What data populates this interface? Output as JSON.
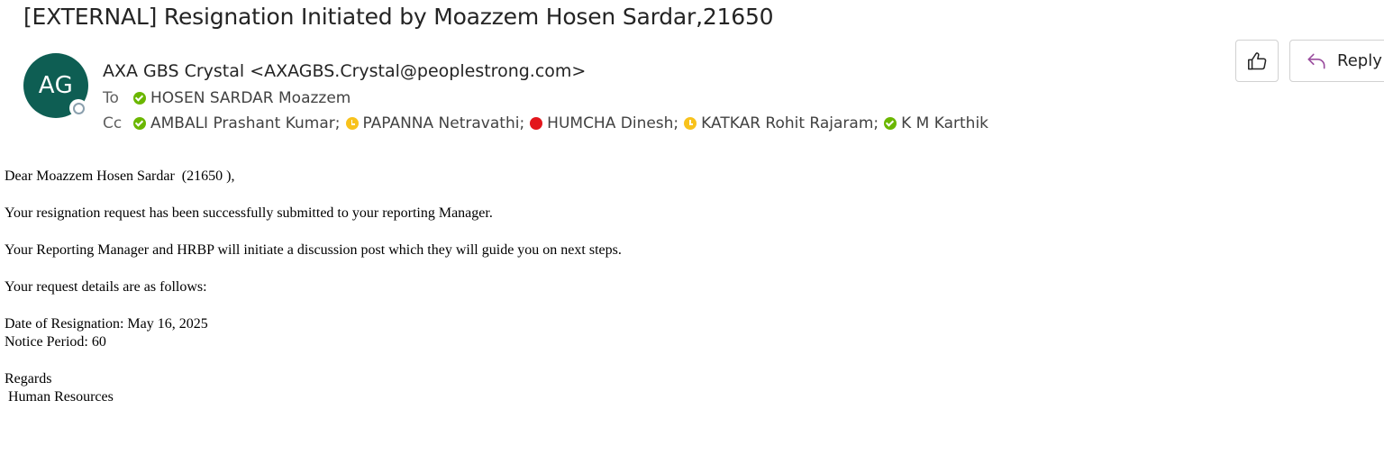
{
  "email": {
    "subject": "[EXTERNAL] Resignation Initiated by Moazzem Hosen Sardar,21650",
    "sender": {
      "initials": "AG",
      "display": "AXA GBS Crystal <AXAGBS.Crystal@peoplestrong.com>",
      "avatar_color": "#0e5e53"
    },
    "to_label": "To",
    "cc_label": "Cc",
    "to": [
      {
        "name": "HOSEN SARDAR Moazzem",
        "status": "available"
      }
    ],
    "cc": [
      {
        "name": "AMBALI Prashant Kumar;",
        "status": "available"
      },
      {
        "name": "PAPANNA Netravathi;",
        "status": "away"
      },
      {
        "name": "HUMCHA Dinesh;",
        "status": "busy"
      },
      {
        "name": "KATKAR Rohit Rajaram;",
        "status": "away"
      },
      {
        "name": "K M Karthik",
        "status": "available"
      }
    ]
  },
  "actions": {
    "like_icon": "thumbs-up-icon",
    "reply_icon": "reply-arrow-icon",
    "reply_label": "Reply"
  },
  "body": {
    "greeting": "Dear Moazzem Hosen Sardar  (21650 ),",
    "line1": "Your resignation request has been successfully submitted to your reporting Manager.",
    "line2": "Your Reporting Manager and HRBP will initiate a discussion post which they will guide you on next steps.",
    "line3": "Your request details are as follows:",
    "date_line": "Date of Resignation: May 16, 2025",
    "notice_line": "Notice Period: 60",
    "regards": "Regards",
    "signature": " Human Resources"
  },
  "colors": {
    "available": "#6bb700",
    "away": "#f8c21c",
    "busy": "#e3161c",
    "reply_icon": "#9a4d9e"
  }
}
